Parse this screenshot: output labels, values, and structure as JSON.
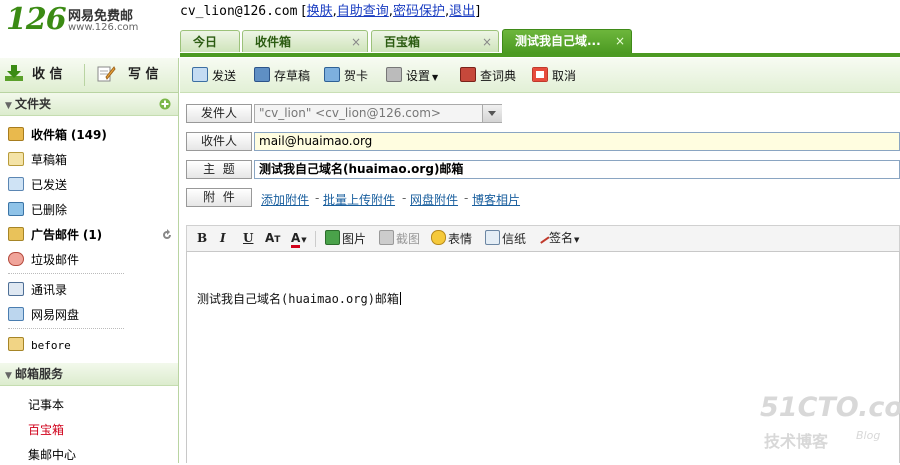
{
  "header": {
    "logo_number": "126",
    "logo_text": "网易免费邮",
    "logo_url": "www.126.com",
    "user_email": "cv_lion@126.com",
    "bracket_open": "[",
    "bracket_close": "]",
    "links": [
      "换肤",
      "自助查询",
      "密码保护",
      "退出"
    ]
  },
  "tabs": [
    {
      "label": "今日",
      "closable": false,
      "active": false
    },
    {
      "label": "收件箱",
      "closable": true,
      "active": false
    },
    {
      "label": "百宝箱",
      "closable": true,
      "active": false
    },
    {
      "label": "测试我自己域...",
      "closable": true,
      "active": true
    }
  ],
  "tab_close_glyph": "×",
  "sidebar": {
    "receive_label": "收 信",
    "write_label": "写 信",
    "folders_heading": "文件夹",
    "folders": [
      {
        "label": "收件箱",
        "count": "(149)",
        "bold": true
      },
      {
        "label": "草稿箱",
        "count": "",
        "bold": false
      },
      {
        "label": "已发送",
        "count": "",
        "bold": false
      },
      {
        "label": "已删除",
        "count": "",
        "bold": false
      },
      {
        "label": "广告邮件",
        "count": "(1)",
        "bold": true
      },
      {
        "label": "垃圾邮件",
        "count": "",
        "bold": false
      },
      {
        "label": "通讯录",
        "count": "",
        "bold": false
      },
      {
        "label": "网易网盘",
        "count": "",
        "bold": false
      },
      {
        "label": "before",
        "count": "",
        "bold": false
      }
    ],
    "services_heading": "邮箱服务",
    "services": [
      {
        "label": "记事本",
        "highlight": false
      },
      {
        "label": "百宝箱",
        "highlight": true
      },
      {
        "label": "集邮中心",
        "highlight": false
      }
    ]
  },
  "toolbar": {
    "send": "发送",
    "save_draft": "存草稿",
    "card": "贺卡",
    "settings": "设置",
    "dictionary": "查词典",
    "cancel": "取消"
  },
  "compose": {
    "sender_label": "发件人",
    "sender_value": "\"cv_lion\" <cv_lion@126.com>",
    "recipient_label": "收件人",
    "recipient_value": "mail@huaimao.org",
    "subject_label": "主  题",
    "subject_value": "测试我自己域名(huaimao.org)邮箱",
    "attach_label": "附  件",
    "attach_links": [
      "添加附件",
      "批量上传附件",
      "网盘附件",
      "博客相片"
    ],
    "attach_separator": "-"
  },
  "editor": {
    "bold": "B",
    "italic": "I",
    "underline": "U",
    "font_size": "A",
    "font_color": "A",
    "image": "图片",
    "screenshot": "截图",
    "emoticon": "表情",
    "stationery": "信纸",
    "signature": "签名",
    "body_text": "测试我自己域名(huaimao.org)邮箱"
  },
  "watermark": {
    "line1": "51CTO.com",
    "line2": "技术博客",
    "line3": "Blog"
  },
  "colors": {
    "brand_green": "#3b8b14",
    "tab_active": "#4c9a22",
    "link_blue": "#1a3dc1",
    "highlight_red": "#d0021b"
  }
}
